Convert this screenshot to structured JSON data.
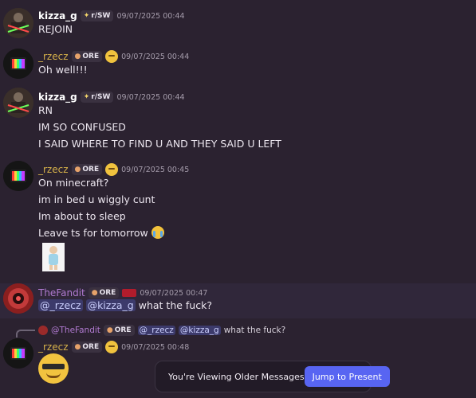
{
  "messages": [
    {
      "user": "kizza_g",
      "tag": "r/SW",
      "timestamp": "09/07/2025 00:44",
      "lines": [
        "REJOIN"
      ]
    },
    {
      "user": "_rzecz",
      "tag": "ORE",
      "timestamp": "09/07/2025 00:44",
      "lines": [
        "Oh well!!!"
      ]
    },
    {
      "user": "kizza_g",
      "tag": "r/SW",
      "timestamp": "09/07/2025 00:44",
      "lines": [
        "RN",
        "IM SO CONFUSED",
        "I SAID WHERE TO FIND U AND THEY SAID U LEFT"
      ]
    },
    {
      "user": "_rzecz",
      "tag": "ORE",
      "timestamp": "09/07/2025 00:45",
      "lines": [
        "On minecraft?",
        "im in bed u wiggly cunt",
        "Im about to sleep",
        "Leave ts for tomorrow"
      ]
    },
    {
      "user": "TheFandit",
      "tag": "ORE",
      "timestamp": "09/07/2025 00:47",
      "mentions": [
        "@_rzecz",
        "@kizza_g"
      ],
      "text": "what the fuck?"
    },
    {
      "reply_to": {
        "user": "@TheFandit",
        "tag": "ORE",
        "mentions": [
          "@_rzecz",
          "@kizza_g"
        ],
        "text": "what the fuck?"
      },
      "user": "_rzecz",
      "tag": "ORE",
      "timestamp": "09/07/2025 00:48"
    }
  ],
  "banner": {
    "text": "You're Viewing Older Messages",
    "button": "Jump to Present"
  }
}
